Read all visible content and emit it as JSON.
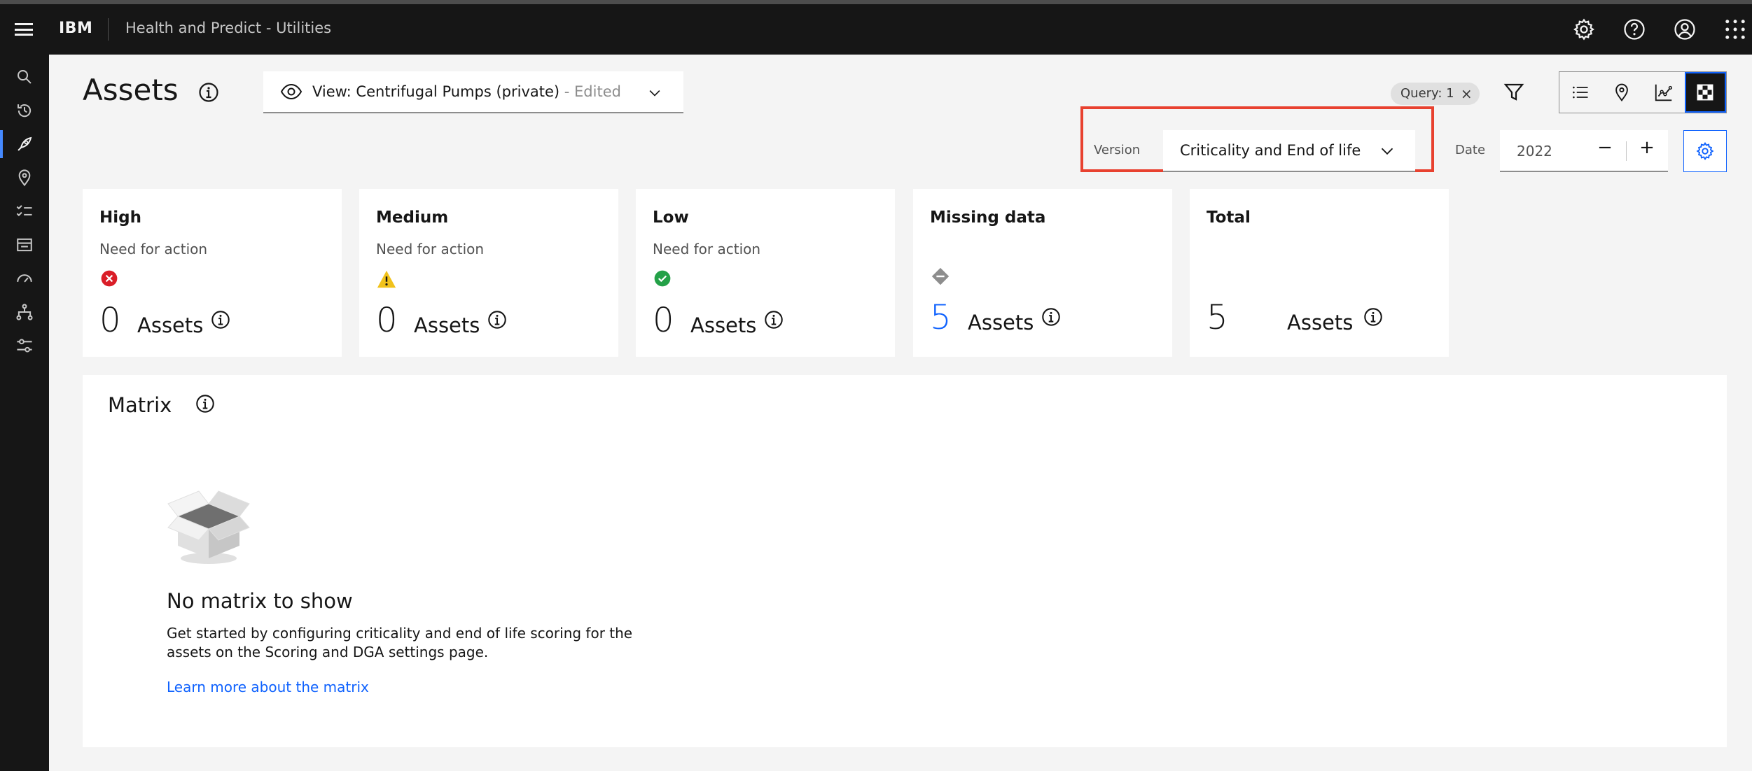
{
  "header": {
    "brand": "IBM",
    "app_name": "Health and Predict - Utilities",
    "icons": [
      "settings-icon",
      "help-icon",
      "user-icon",
      "app-switcher-icon"
    ]
  },
  "leftnav": {
    "items": [
      {
        "icon": "search-icon",
        "active": false
      },
      {
        "icon": "history-icon",
        "active": false
      },
      {
        "icon": "rocket-icon",
        "active": true
      },
      {
        "icon": "location-icon",
        "active": false
      },
      {
        "icon": "checklist-icon",
        "active": false
      },
      {
        "icon": "dashboard-icon",
        "active": false
      },
      {
        "icon": "meter-icon",
        "active": false
      },
      {
        "icon": "hierarchy-icon",
        "active": false
      },
      {
        "icon": "sliders-icon",
        "active": false
      }
    ]
  },
  "page": {
    "title": "Assets"
  },
  "view_select": {
    "label": "View: Centrifugal Pumps (private)",
    "edited": " - Edited"
  },
  "query_tag": {
    "label": "Query: 1",
    "close": "×"
  },
  "view_switcher": {
    "buttons": [
      "list-view-icon",
      "map-view-icon",
      "chart-view-icon",
      "matrix-view-icon"
    ],
    "active": "matrix-view-icon"
  },
  "version": {
    "label": "Version",
    "value": "Criticality and End of life"
  },
  "date": {
    "label": "Date",
    "value": "2022",
    "decrement": "−",
    "increment": "+"
  },
  "cards": [
    {
      "title": "High",
      "subtitle": "Need for action",
      "status_icon": "error-icon",
      "count": "0",
      "unit": "Assets"
    },
    {
      "title": "Medium",
      "subtitle": "Need for action",
      "status_icon": "warning-icon",
      "count": "0",
      "unit": "Assets"
    },
    {
      "title": "Low",
      "subtitle": "Need for action",
      "status_icon": "success-icon",
      "count": "0",
      "unit": "Assets"
    },
    {
      "title": "Missing data",
      "subtitle": "",
      "status_icon": "missing-data-icon",
      "count": "5",
      "unit": "Assets"
    },
    {
      "title": "Total",
      "subtitle": "",
      "status_icon": "",
      "count": "5",
      "unit": "Assets"
    }
  ],
  "matrix": {
    "title": "Matrix",
    "empty_title": "No matrix to show",
    "empty_desc": "Get started by configuring criticality and end of life scoring for the assets on the Scoring and DGA settings page.",
    "link": "Learn more about the matrix"
  },
  "colors": {
    "header_bg": "#161616",
    "accent": "#0f62fe",
    "highlight": "#e8412f",
    "error": "#da1e28",
    "warning": "#f1c21b",
    "success": "#24a148"
  }
}
